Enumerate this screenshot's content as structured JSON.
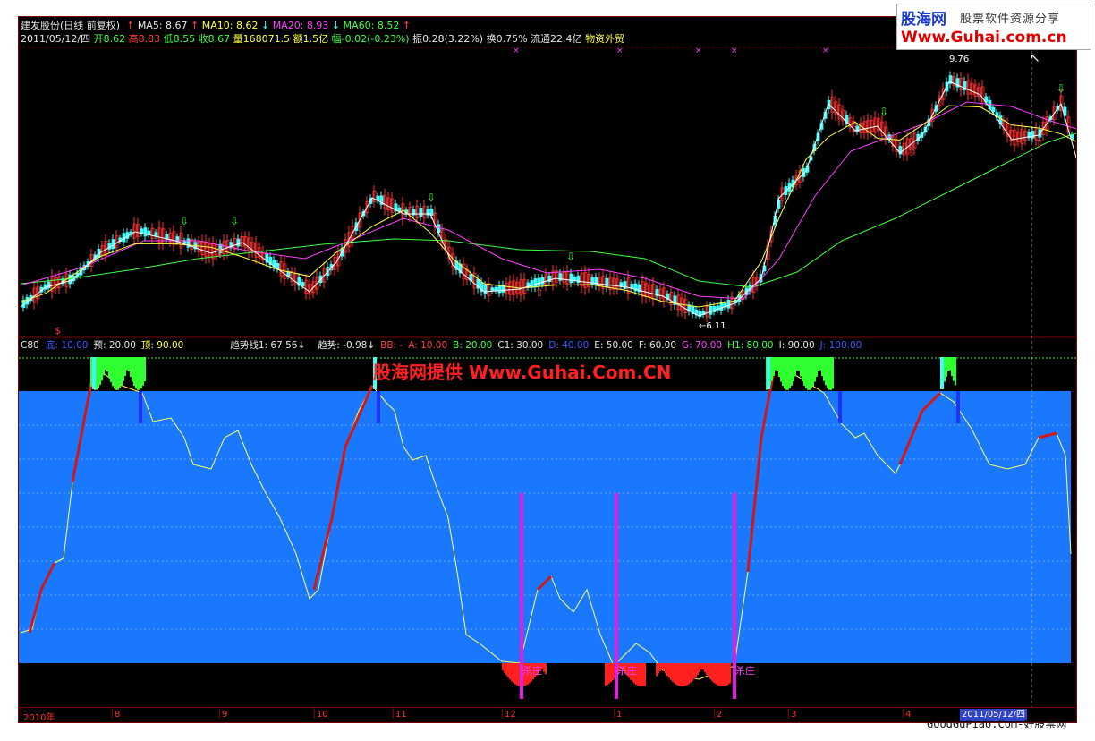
{
  "header": {
    "title": "建发股份(日线 前复权)",
    "ma5": "MA5: 8.67",
    "ma10": "MA10: 8.62",
    "ma20": "MA20: 8.93",
    "ma60": "MA60: 8.52",
    "date": "2011/05/12/四",
    "open": "开8.62",
    "high": "高8.83",
    "low": "低8.55",
    "close": "收8.67",
    "volume": "量168071.5",
    "amount": "额1.5亿",
    "change": "幅-0.02(-0.23%)",
    "swing": "振0.28(3.22%)",
    "turnover": "换0.75%",
    "float": "流通22.4亿",
    "sector": "物资外贸"
  },
  "price_chart": {
    "high_marker": "9.76",
    "low_marker": "←6.11"
  },
  "indicator": {
    "name": "C80",
    "params": [
      {
        "text": "底: 10.00",
        "color": "#3a5bff"
      },
      {
        "text": "预: 20.00",
        "color": "#e6e6e6"
      },
      {
        "text": "顶: 90.00",
        "color": "#ffff40"
      },
      {
        "text": "趋势线1: 67.56↓",
        "color": "#e6e6e6"
      },
      {
        "text": "趋势: -0.98↓",
        "color": "#e6e6e6"
      },
      {
        "text": "BB: -",
        "color": "#ff4040"
      },
      {
        "text": "A: 10.00",
        "color": "#ff4040"
      },
      {
        "text": "B: 20.00",
        "color": "#40ff40"
      },
      {
        "text": "C1: 30.00",
        "color": "#e6e6e6"
      },
      {
        "text": "D: 40.00",
        "color": "#3a5bff"
      },
      {
        "text": "E: 50.00",
        "color": "#e6e6e6"
      },
      {
        "text": "F: 60.00",
        "color": "#e6e6e6"
      },
      {
        "text": "G: 70.00",
        "color": "#ff40ff"
      },
      {
        "text": "H1: 80.00",
        "color": "#40ff40"
      },
      {
        "text": "I: 90.00",
        "color": "#e6e6e6"
      },
      {
        "text": "J: 100.00",
        "color": "#3a5bff"
      }
    ],
    "signal_label": "杀庄"
  },
  "watermark": "股海网提供 Www.Guhai.Com.CN",
  "x_axis": {
    "ticks": [
      "2010年",
      "8",
      "9",
      "10",
      "11",
      "12",
      "1",
      "2",
      "3",
      "4"
    ],
    "current_date": "2011/05/12/四"
  },
  "logo": {
    "title": "股海网",
    "subtitle": "股票软件资源分享",
    "url": "Www.Guhai.com.cn"
  },
  "footer": "GoodGuPiao.Com-好股票网",
  "colors": {
    "up": "#ff3030",
    "down": "#40ffff",
    "ma5": "#ffffff",
    "ma10": "#ffff40",
    "ma20": "#ff40ff",
    "ma60": "#40ff40",
    "indicator_band": "#1a78ff"
  },
  "icons": [
    "up-arrow-icon",
    "down-arrow-icon",
    "cursor-icon"
  ]
}
